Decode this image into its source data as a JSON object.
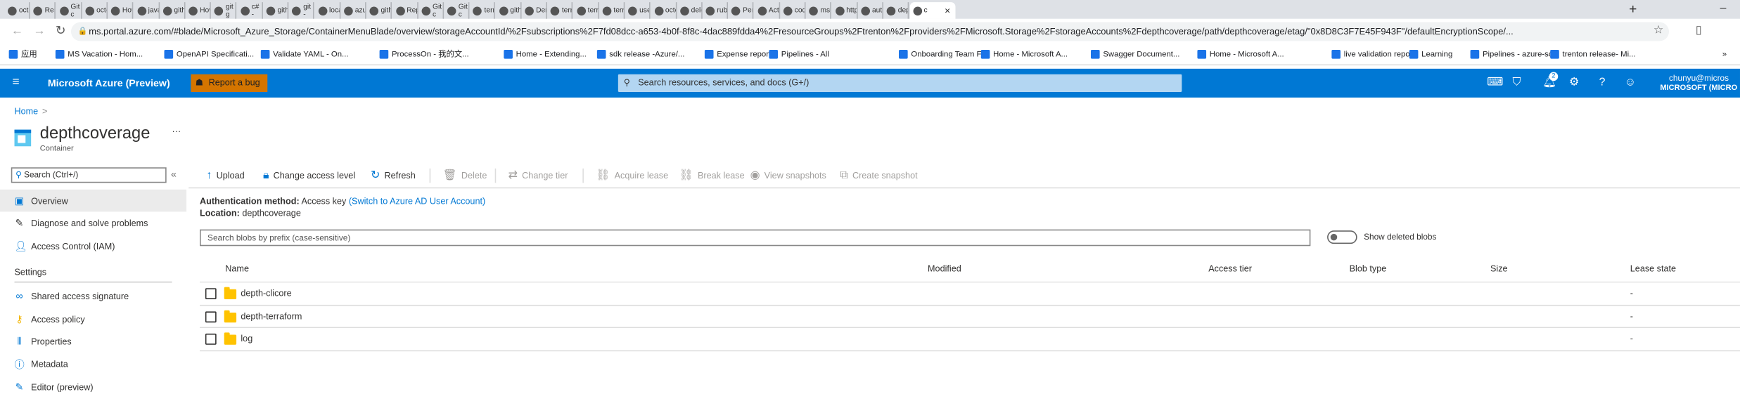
{
  "browser": {
    "tabs": [
      "octo",
      "Repo",
      "Git c",
      "octo",
      "How",
      "javas",
      "githu",
      "How",
      "git g",
      "c# -",
      "githu",
      "git -",
      "local",
      "azur",
      "githu",
      "Repo",
      "Git c",
      "Git c",
      "terra",
      "githu",
      "Dem",
      "terra",
      "terra",
      "terra",
      "use",
      "octo",
      "dele",
      "ruby",
      "Pers",
      "Actio",
      "code",
      "mssi",
      "http",
      "auto",
      "dept",
      "c"
    ],
    "new_tab": "+",
    "url": "ms.portal.azure.com/#blade/Microsoft_Azure_Storage/ContainerMenuBlade/overview/storageAccountId/%2Fsubscriptions%2F7fd08dcc-a653-4b0f-8f8c-4dac889fdda4%2FresourceGroups%2Ftrenton%2Fproviders%2FMicrosoft.Storage%2FstorageAccounts%2Fdepthcoverage/path/depthcoverage/etag/\"0x8D8C3F7E45F943F\"/defaultEncryptionScope/...",
    "bookmarks": [
      "应用",
      "MS Vacation - Hom...",
      "OpenAPI Specificati...",
      "Validate YAML - On...",
      "ProcessOn - 我的文...",
      "Home - Extending...",
      "sdk release -Azure/...",
      "Expense reports",
      "Pipelines - All",
      "Onboarding Team F...",
      "Home - Microsoft A...",
      "Swagger Document...",
      "Home - Microsoft A...",
      "live validation report",
      "Learning",
      "Pipelines - azure-sdk",
      "trenton release- Mi..."
    ],
    "more_bookmarks": "»"
  },
  "header": {
    "title": "Microsoft Azure (Preview)",
    "bug_label": "Report a bug",
    "search_placeholder": "Search resources, services, and docs (G+/)",
    "notification_count": "2",
    "user": "chunyu@micros",
    "tenant": "MICROSOFT (MICRO"
  },
  "breadcrumb": {
    "home": "Home",
    "sep": ">"
  },
  "resource": {
    "name": "depthcoverage",
    "type": "Container",
    "more": "···"
  },
  "sidebar": {
    "search_placeholder": "Search (Ctrl+/)",
    "collapse": "«",
    "items": [
      {
        "label": "Overview",
        "icon": "container-icon"
      },
      {
        "label": "Diagnose and solve problems",
        "icon": "wrench-icon"
      },
      {
        "label": "Access Control (IAM)",
        "icon": "people-icon"
      }
    ],
    "settings_heading": "Settings",
    "settings": [
      {
        "label": "Shared access signature",
        "icon": "link-icon"
      },
      {
        "label": "Access policy",
        "icon": "key-icon"
      },
      {
        "label": "Properties",
        "icon": "properties-icon"
      },
      {
        "label": "Metadata",
        "icon": "info-icon"
      },
      {
        "label": "Editor (preview)",
        "icon": "pencil-icon"
      }
    ]
  },
  "toolbar": {
    "upload": "Upload",
    "change_access": "Change access level",
    "refresh": "Refresh",
    "delete": "Delete",
    "change_tier": "Change tier",
    "acquire_lease": "Acquire lease",
    "break_lease": "Break lease",
    "view_snapshots": "View snapshots",
    "create_snapshot": "Create snapshot"
  },
  "info": {
    "auth_label": "Authentication method:",
    "auth_value": "Access key",
    "auth_link": "(Switch to Azure AD User Account)",
    "location_label": "Location:",
    "location_value": "depthcoverage"
  },
  "filter": {
    "placeholder": "Search blobs by prefix (case-sensitive)",
    "toggle_label": "Show deleted blobs",
    "toggle_on": false
  },
  "table": {
    "columns": [
      "Name",
      "Modified",
      "Access tier",
      "Blob type",
      "Size",
      "Lease state"
    ],
    "rows": [
      {
        "name": "depth-clicore",
        "lease": "-"
      },
      {
        "name": "depth-terraform",
        "lease": "-"
      },
      {
        "name": "log",
        "lease": "-"
      }
    ]
  }
}
